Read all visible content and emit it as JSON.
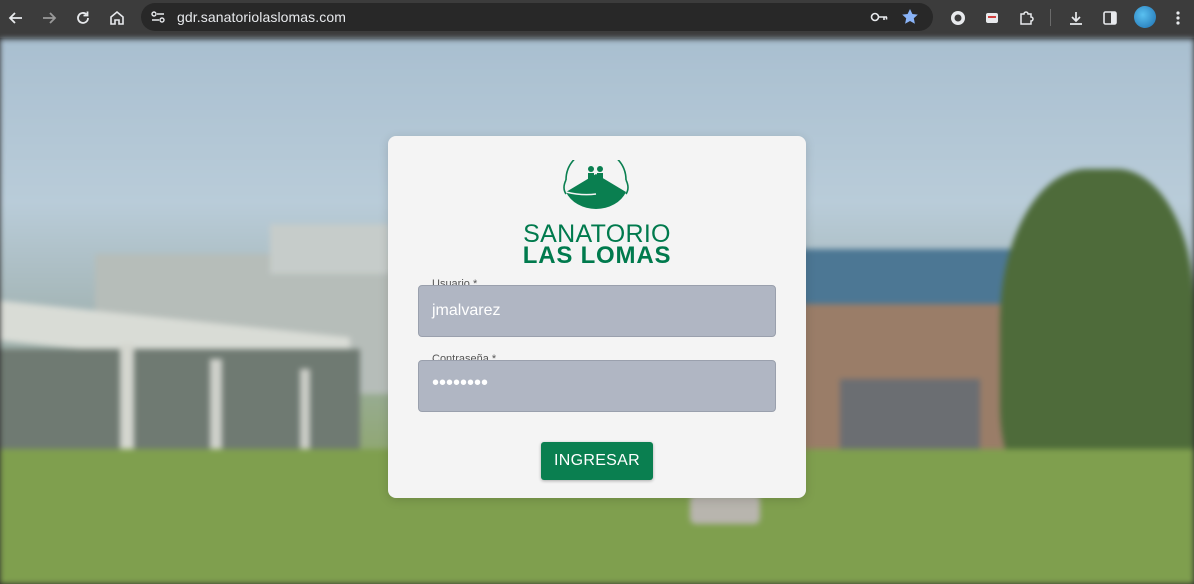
{
  "browser": {
    "url": "gdr.sanatoriolaslomas.com",
    "icons": [
      "back-icon",
      "forward-icon",
      "reload-icon",
      "home-icon",
      "site-info-icon",
      "password-key-icon",
      "bookmark-star-icon",
      "extension-circle-icon",
      "extension-icon",
      "puzzle-icon",
      "download-icon",
      "side-panel-icon",
      "profile-avatar",
      "menu-icon"
    ]
  },
  "login": {
    "logo_line1": "SANATORIO",
    "logo_line2": "LAS LOMAS",
    "username_label": "Usuario *",
    "username_value": "jmalvarez",
    "password_label": "Contraseña *",
    "password_value": "••••••••",
    "submit_label": "INGRESAR"
  },
  "colors": {
    "brand_green": "#007a4d",
    "button_green": "#0a7f50",
    "field_bg": "#b0b6c3",
    "card_bg": "#f4f4f4"
  }
}
